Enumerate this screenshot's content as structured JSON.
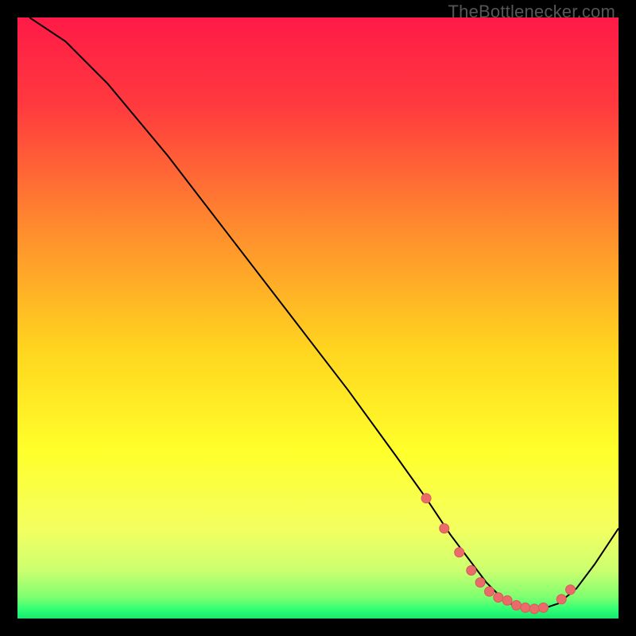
{
  "watermark": "TheBottlenecker.com",
  "colors": {
    "gradient_stops": [
      {
        "offset": 0.0,
        "color": "#ff1a47"
      },
      {
        "offset": 0.15,
        "color": "#ff3b3e"
      },
      {
        "offset": 0.35,
        "color": "#ff8b2e"
      },
      {
        "offset": 0.55,
        "color": "#ffd41f"
      },
      {
        "offset": 0.72,
        "color": "#ffff2a"
      },
      {
        "offset": 0.85,
        "color": "#f4ff60"
      },
      {
        "offset": 0.92,
        "color": "#ccff70"
      },
      {
        "offset": 0.965,
        "color": "#7dff70"
      },
      {
        "offset": 0.985,
        "color": "#2fff74"
      },
      {
        "offset": 1.0,
        "color": "#18e86d"
      }
    ],
    "curve_color": "#000000",
    "dot_color": "#eb6a6a",
    "dot_stroke": "#d85a5a"
  },
  "chart_data": {
    "type": "line",
    "title": "",
    "xlabel": "",
    "ylabel": "",
    "xlim": [
      0,
      100
    ],
    "ylim": [
      0,
      100
    ],
    "series": [
      {
        "name": "bottleneck-curve",
        "x": [
          2,
          8,
          15,
          25,
          35,
          45,
          55,
          63,
          68,
          72,
          75,
          78,
          81,
          83,
          85,
          87,
          90,
          93,
          96,
          100
        ],
        "y": [
          100,
          96,
          89,
          77,
          64,
          51,
          38,
          27,
          20,
          14,
          10,
          6,
          3,
          2,
          1.5,
          1.5,
          2.5,
          5,
          9,
          15
        ]
      }
    ],
    "dots": {
      "name": "highlight-points",
      "x": [
        68,
        71,
        73.5,
        75.5,
        77,
        78.5,
        80,
        81.5,
        83,
        84.5,
        86,
        87.5,
        90.5,
        92
      ],
      "y": [
        20,
        15,
        11,
        8,
        6,
        4.5,
        3.5,
        3,
        2.2,
        1.8,
        1.6,
        1.8,
        3.2,
        4.8
      ]
    }
  }
}
